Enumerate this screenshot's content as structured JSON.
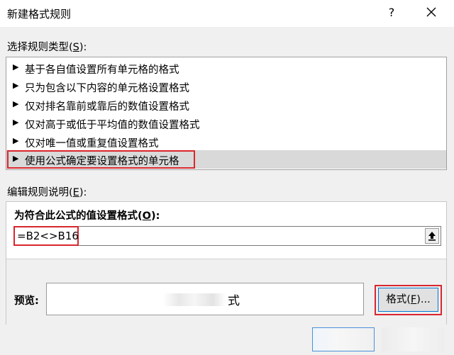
{
  "dialog": {
    "title": "新建格式规则",
    "help_label": "?"
  },
  "rule_type": {
    "label_prefix": "选择规则类型(",
    "label_key": "S",
    "label_suffix": "):",
    "items": [
      {
        "label": "基于各自值设置所有单元格的格式",
        "selected": false
      },
      {
        "label": "只为包含以下内容的单元格设置格式",
        "selected": false
      },
      {
        "label": "仅对排名靠前或靠后的数值设置格式",
        "selected": false
      },
      {
        "label": "仅对高于或低于平均值的数值设置格式",
        "selected": false
      },
      {
        "label": "仅对唯一值或重复值设置格式",
        "selected": false
      },
      {
        "label": "使用公式确定要设置格式的单元格",
        "selected": true
      }
    ]
  },
  "description": {
    "label_prefix": "编辑规则说明(",
    "label_key": "E",
    "label_suffix": "):",
    "formula_label_prefix": "为符合此公式的值设置格式(",
    "formula_label_key": "O",
    "formula_label_suffix": "):",
    "formula_value": "=B2<>B16",
    "preview_label": "预览:",
    "preview_text": "式",
    "format_button_prefix": "格式(",
    "format_button_key": "F",
    "format_button_suffix": ")..."
  },
  "colors": {
    "highlight_border": "#d9262e",
    "selected_row": "#d9d9d9",
    "focus_border": "#0078d4"
  }
}
